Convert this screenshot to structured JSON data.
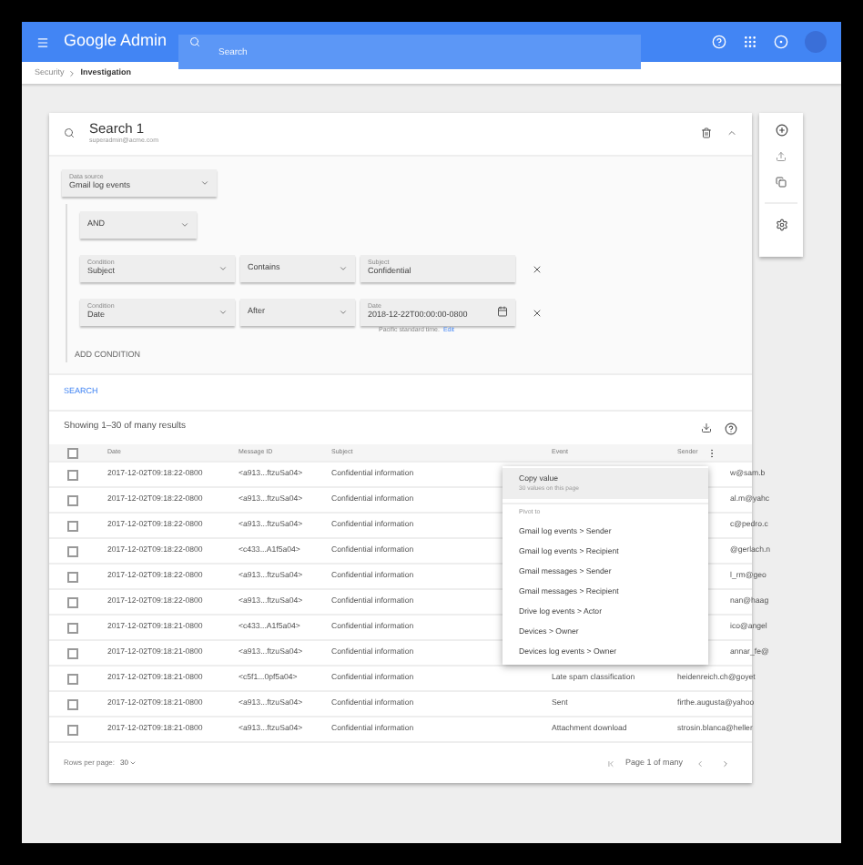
{
  "topbar": {
    "product": "Google Admin",
    "search_placeholder": "Search"
  },
  "breadcrumb": [
    "Security",
    "Investigation"
  ],
  "search": {
    "title": "Search 1",
    "owner": "superadmin@acme.com",
    "data_source": {
      "label": "Data source",
      "value": "Gmail log events"
    },
    "operator": "AND",
    "conditions": [
      {
        "kind": "text",
        "field_label": "Condition",
        "field": "Subject",
        "operator": "Contains",
        "value_label": "Subject",
        "value": "Confidential"
      },
      {
        "kind": "date",
        "field_label": "Condition",
        "field": "Date",
        "operator": "After",
        "value_label": "Date",
        "value": "2018-12-22T00:00:00-0800",
        "hint": "Pacific standard time.",
        "hint_link": "Edit"
      }
    ],
    "add_condition": "ADD CONDITION",
    "search_button": "SEARCH"
  },
  "results": {
    "summary": "Showing 1–30 of many results",
    "all_checked": false,
    "columns": [
      "Date",
      "Message ID",
      "Subject",
      "Event",
      "Sender"
    ],
    "rows": [
      {
        "checked": false,
        "date": "2017-12-02T09:18:22-0800",
        "message_id": "<a913...ftzuSa04>",
        "subject": "Confidential information",
        "sender": "w@sam.b"
      },
      {
        "checked": false,
        "date": "2017-12-02T09:18:22-0800",
        "message_id": "<a913...ftzuSa04>",
        "subject": "Confidential information",
        "sender": "al.m@yahc"
      },
      {
        "checked": false,
        "date": "2017-12-02T09:18:22-0800",
        "message_id": "<a913...ftzuSa04>",
        "subject": "Confidential information",
        "sender": "c@pedro.c"
      },
      {
        "checked": false,
        "date": "2017-12-02T09:18:22-0800",
        "message_id": "<c433...A1f5a04>",
        "subject": "Confidential information",
        "sender": "@gerlach.n"
      },
      {
        "checked": false,
        "date": "2017-12-02T09:18:22-0800",
        "message_id": "<a913...ftzuSa04>",
        "subject": "Confidential information",
        "sender": "l_rm@geo"
      },
      {
        "checked": false,
        "date": "2017-12-02T09:18:22-0800",
        "message_id": "<a913...ftzuSa04>",
        "subject": "Confidential information",
        "sender": "nan@haag"
      },
      {
        "checked": false,
        "date": "2017-12-02T09:18:21-0800",
        "message_id": "<c433...A1f5a04>",
        "subject": "Confidential information",
        "sender": "ico@angel"
      },
      {
        "checked": false,
        "date": "2017-12-02T09:18:21-0800",
        "message_id": "<a913...ftzuSa04>",
        "subject": "Confidential information",
        "sender": "annar_fe@"
      },
      {
        "checked": false,
        "date": "2017-12-02T09:18:21-0800",
        "message_id": "<c5f1...0pf5a04>",
        "subject": "Confidential information",
        "event": "Late spam classification",
        "sender": "heidenreich.ch@goyet"
      },
      {
        "checked": false,
        "date": "2017-12-02T09:18:21-0800",
        "message_id": "<a913...ftzuSa04>",
        "subject": "Confidential information",
        "event": "Sent",
        "sender": "firthe.augusta@yahoo"
      },
      {
        "checked": false,
        "date": "2017-12-02T09:18:21-0800",
        "message_id": "<a913...ftzuSa04>",
        "subject": "Confidential information",
        "event": "Attachment download",
        "sender": "strosin.blanca@heller"
      }
    ],
    "rows_per_page_label": "Rows per page:",
    "rows_per_page": "30",
    "page": "Page 1 of many"
  },
  "menu": {
    "items": [
      {
        "kind": "action",
        "label": "Copy value",
        "detail": "30 values on this page",
        "selected": true
      },
      {
        "kind": "heading",
        "label": "Pivot to"
      },
      {
        "kind": "action",
        "label": "Gmail log events > Sender",
        "selected": false
      },
      {
        "kind": "action",
        "label": "Gmail log events > Recipient",
        "selected": false
      },
      {
        "kind": "action",
        "label": "Gmail messages > Sender",
        "selected": false
      },
      {
        "kind": "action",
        "label": "Gmail messages > Recipient",
        "selected": false
      },
      {
        "kind": "action",
        "label": "Drive log events > Actor",
        "selected": false
      },
      {
        "kind": "action",
        "label": "Devices > Owner",
        "selected": false
      },
      {
        "kind": "action",
        "label": "Devices log events > Owner",
        "selected": false
      }
    ]
  }
}
